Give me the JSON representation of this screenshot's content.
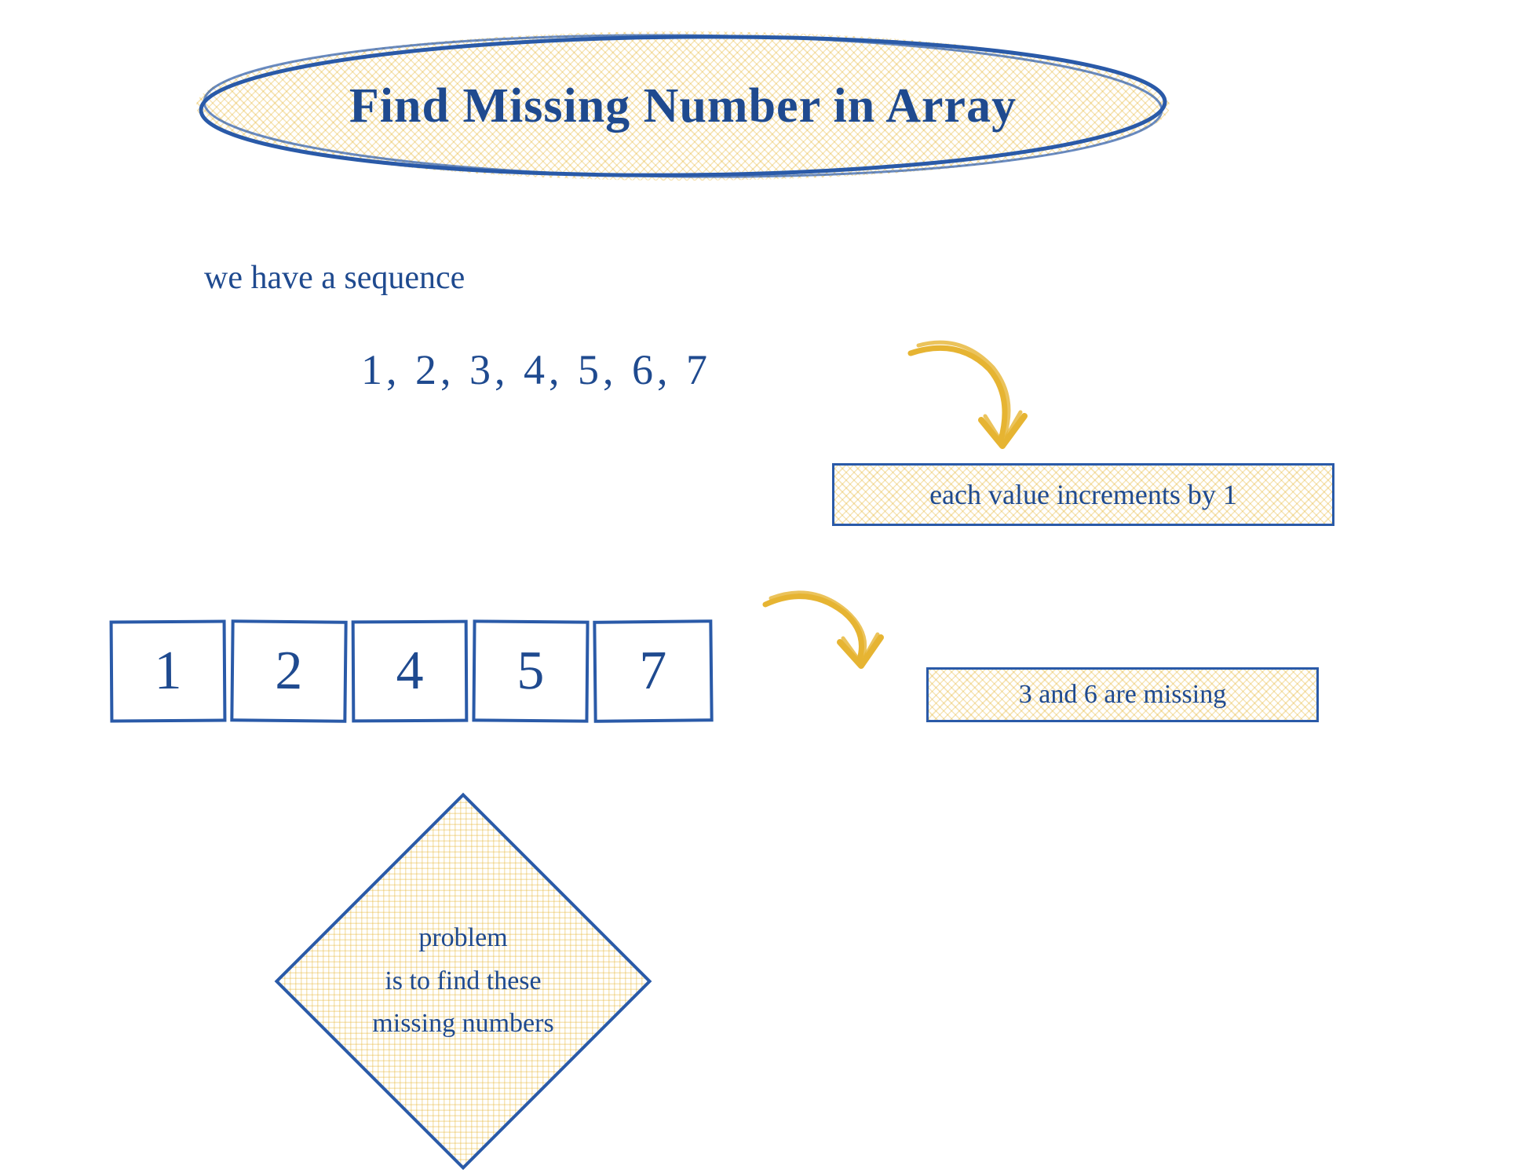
{
  "title": "Find Missing Number in Array",
  "sequence_label": "we have a sequence",
  "sequence_text": "1, 2, 3, 4, 5, 6, 7",
  "callout_increment": "each value increments by 1",
  "array_values": [
    "1",
    "2",
    "4",
    "5",
    "7"
  ],
  "callout_missing": "3 and 6 are missing",
  "diamond_lines": [
    "problem",
    "is to find these",
    "missing numbers"
  ],
  "colors": {
    "ink": "#1f4a8f",
    "highlight": "#e6b432"
  }
}
